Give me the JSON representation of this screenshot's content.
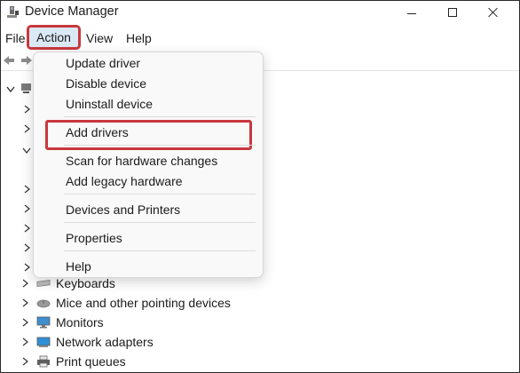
{
  "window": {
    "title": "Device Manager",
    "app_icon": "device-manager-icon",
    "controls": [
      "minimize-icon",
      "maximize-icon",
      "close-icon"
    ]
  },
  "menubar": {
    "items": [
      "File",
      "Action",
      "View",
      "Help"
    ],
    "active": "Action"
  },
  "toolbar": {
    "buttons": [
      "back-arrow-icon",
      "forward-arrow-icon"
    ]
  },
  "action_menu": {
    "groups": [
      [
        "Update driver",
        "Disable device",
        "Uninstall device"
      ],
      [
        "Add drivers"
      ],
      [
        "Scan for hardware changes",
        "Add legacy hardware"
      ],
      [
        "Devices and Printers"
      ],
      [
        "Properties"
      ],
      [
        "Help"
      ]
    ],
    "highlighted_item": "Add drivers"
  },
  "tree": {
    "visible_items": [
      {
        "label": "Keyboards",
        "icon": "keyboard-icon"
      },
      {
        "label": "Mice and other pointing devices",
        "icon": "mouse-icon"
      },
      {
        "label": "Monitors",
        "icon": "monitor-icon"
      },
      {
        "label": "Network adapters",
        "icon": "network-adapter-icon"
      },
      {
        "label": "Print queues",
        "icon": "printer-icon"
      }
    ]
  },
  "colors": {
    "highlight_border": "#c8383c",
    "active_menu_bg": "#dbe9f6"
  }
}
